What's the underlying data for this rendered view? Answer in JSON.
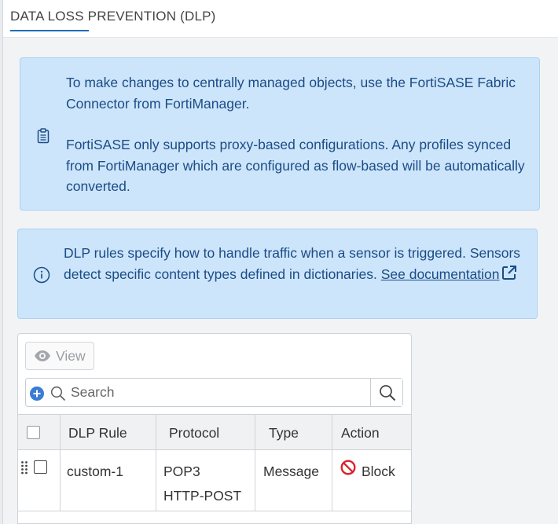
{
  "header": {
    "title": "DATA LOSS PREVENTION (DLP)"
  },
  "notices": {
    "central": {
      "icon": "clipboard-icon",
      "paragraph1": "To make changes to centrally managed objects, use the FortiSASE Fabric Connector from FortiManager.",
      "paragraph2": "FortiSASE only supports proxy-based configurations. Any profiles synced from FortiManager which are configured as flow-based will be automatically converted."
    },
    "info": {
      "icon": "info-circle-icon",
      "text": "DLP rules specify how to handle traffic when a sensor is triggered. Sensors detect specific content types defined in dictionaries.",
      "link_text": "See documentation",
      "link_icon": "external-link-icon"
    }
  },
  "toolbar": {
    "view_label": "View"
  },
  "search": {
    "placeholder": "Search"
  },
  "table": {
    "columns": [
      "DLP Rule",
      "Protocol",
      "Type",
      "Action"
    ],
    "rows": [
      {
        "dlp_rule": "custom-1",
        "protocol_1": "POP3",
        "protocol_2": "HTTP-POST",
        "type": "Message",
        "action": "Block"
      }
    ]
  },
  "colors": {
    "accent": "#1f6bb8",
    "notice_bg": "#cce5fb",
    "notice_text": "#1c4c85",
    "block_red": "#d9232d",
    "plus_blue": "#3a7bd5"
  }
}
